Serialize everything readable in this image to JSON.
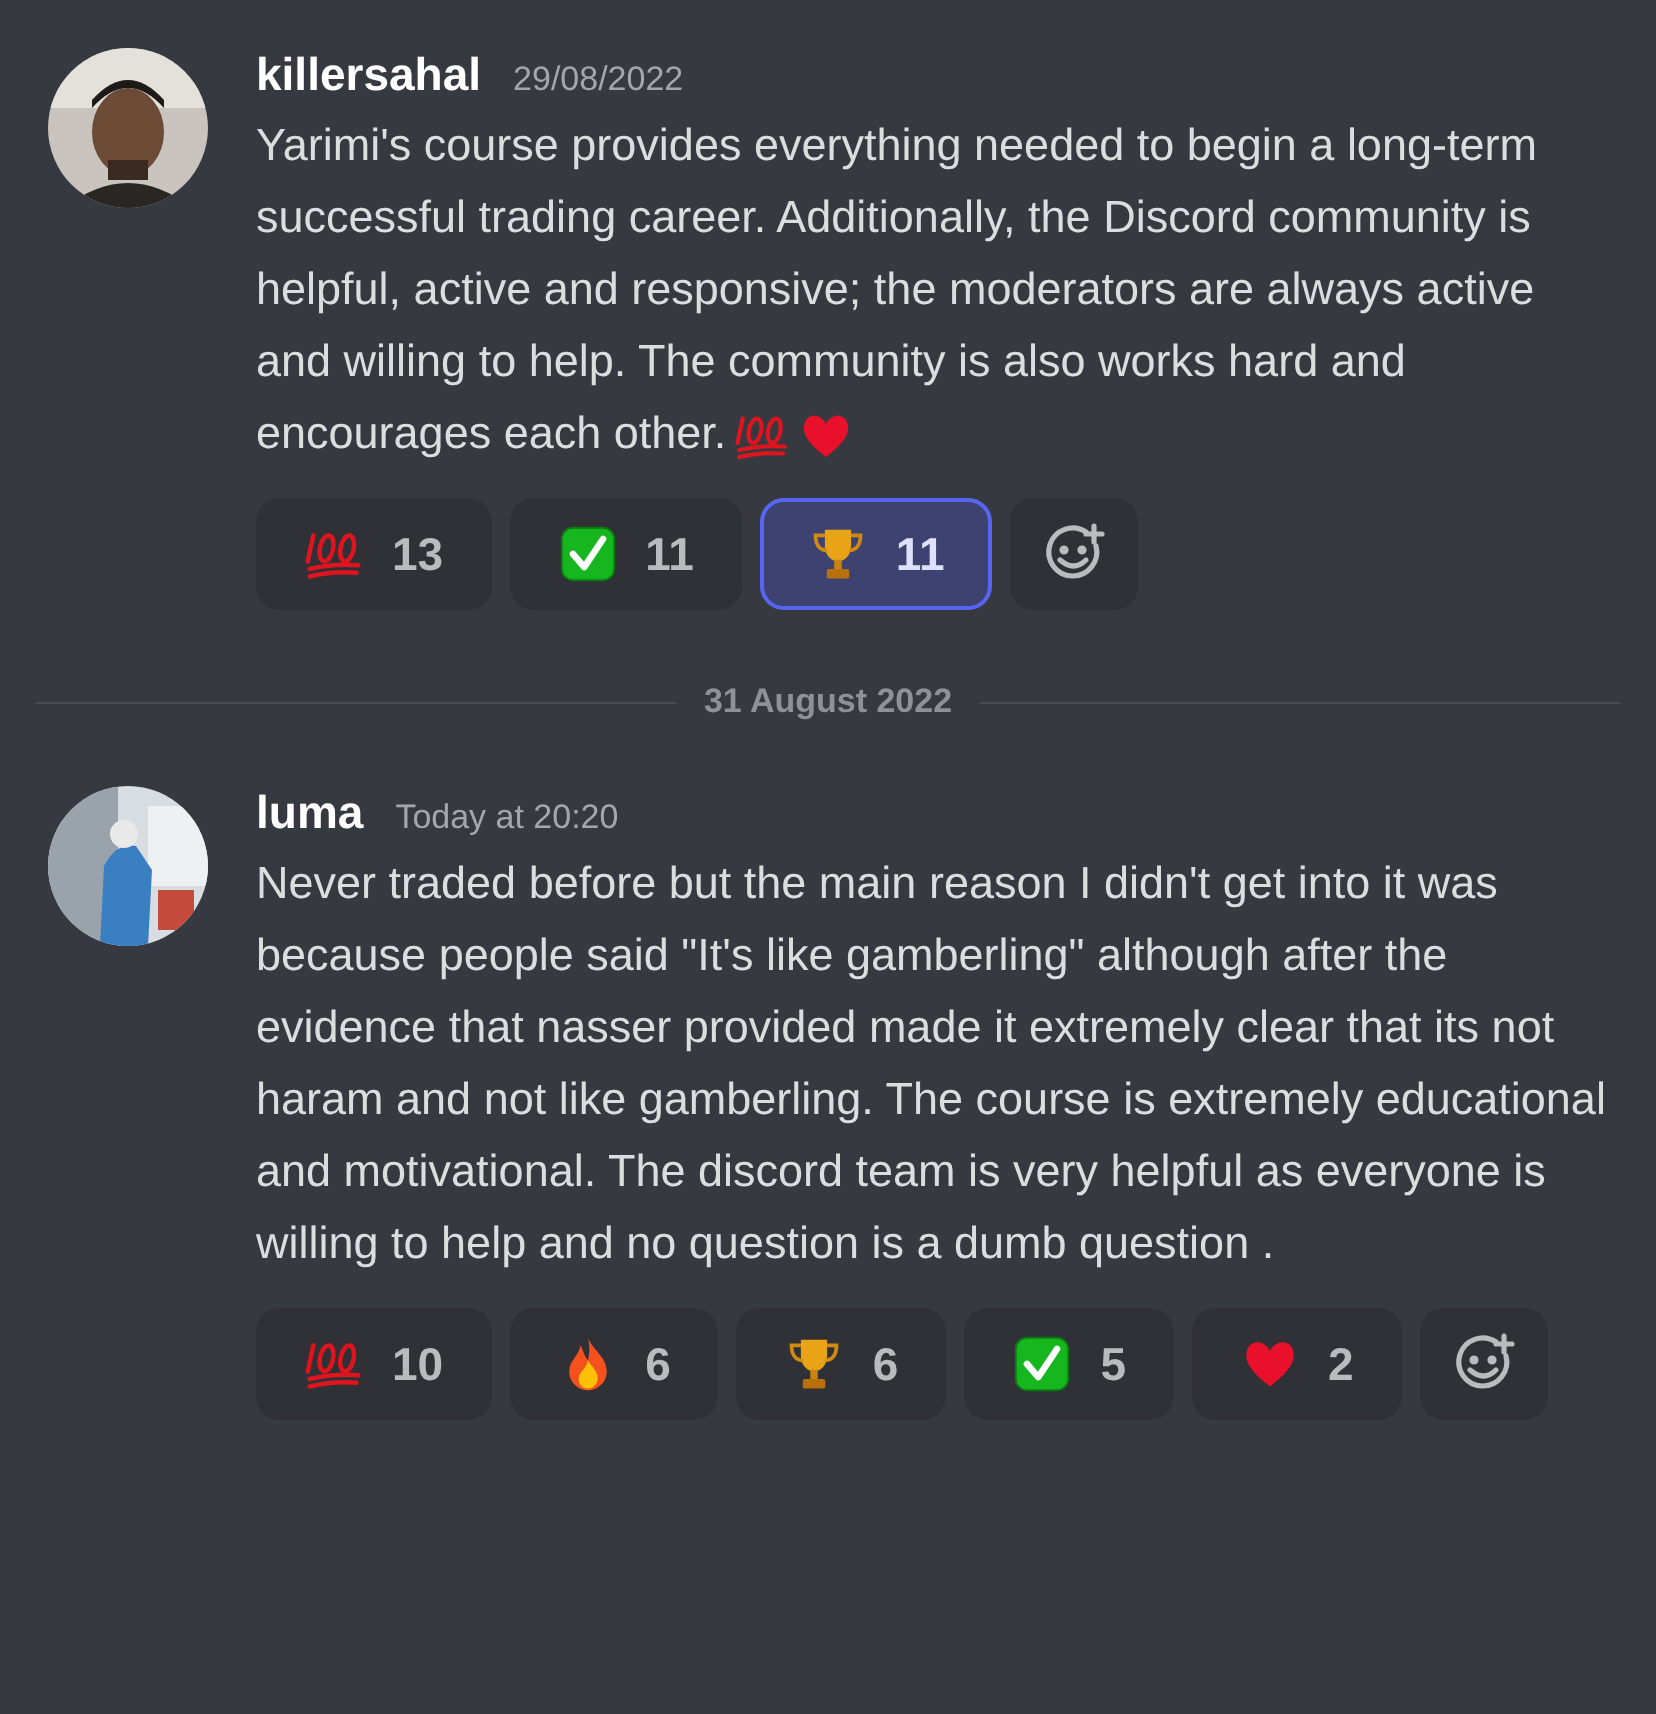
{
  "messages": [
    {
      "author": "killersahal",
      "timestamp": "29/08/2022",
      "avatar": {
        "kind": "picture"
      },
      "content": "Yarimi's course provides everything needed to begin a long-term successful trading career. Additionally, the Discord community is helpful, active and responsive; the moderators are always active and willing to help. The community is also works hard and  encourages each other.",
      "inline_emojis": [
        {
          "kind": "hundred"
        },
        {
          "kind": "heart"
        }
      ],
      "reactions": [
        {
          "kind": "hundred",
          "count": "13",
          "selected": false
        },
        {
          "kind": "check",
          "count": "11",
          "selected": false
        },
        {
          "kind": "trophy",
          "count": "11",
          "selected": true
        }
      ]
    },
    {
      "divider": "31 August 2022"
    },
    {
      "author": "luma",
      "timestamp": "Today at 20:20",
      "avatar": {
        "kind": "picture"
      },
      "content": "Never traded before but the main reason I didn't get into it was because people said \"It's like gamberling\" although after the evidence that nasser provided made it extremely clear that its not haram and not like gamberling. The course is extremely educational and motivational. The discord team is very helpful as everyone is willing to help and no question is a dumb question .",
      "reactions": [
        {
          "kind": "hundred",
          "count": "10",
          "selected": false
        },
        {
          "kind": "fire",
          "count": "6",
          "selected": false
        },
        {
          "kind": "trophy",
          "count": "6",
          "selected": false
        },
        {
          "kind": "check",
          "count": "5",
          "selected": false
        },
        {
          "kind": "heart",
          "count": "2",
          "selected": false
        }
      ]
    }
  ]
}
